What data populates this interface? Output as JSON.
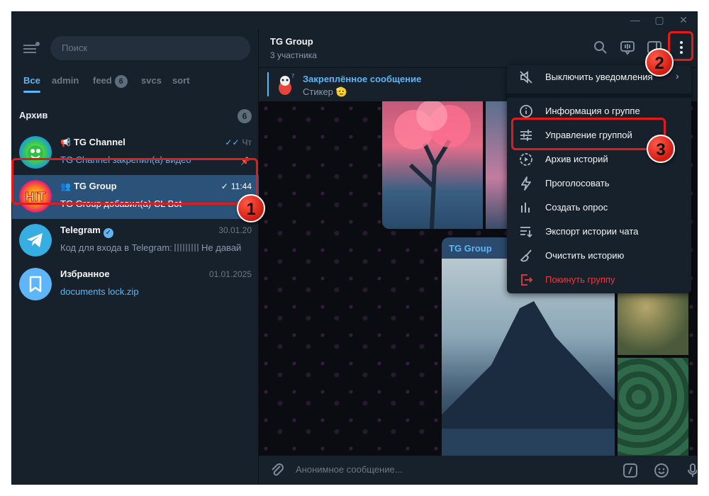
{
  "sidebar": {
    "search_placeholder": "Поиск",
    "tabs": [
      {
        "label": "Все"
      },
      {
        "label": "admin"
      },
      {
        "label": "feed",
        "badge": "6"
      },
      {
        "label": "svcs"
      },
      {
        "label": "sort"
      }
    ],
    "archive": {
      "title": "Архив",
      "count": "6"
    },
    "chats": [
      {
        "name": "TG Channel",
        "time": "Чт",
        "message": "TG Channel закрепил(а) видео"
      },
      {
        "name": "TG Group",
        "time": "11:44",
        "message": "TG Group добавил(а) CL Bot",
        "avatar_text": "HIT"
      },
      {
        "name": "Telegram",
        "time": "30.01.20",
        "message_prefix": "Код для входа в Telegram:",
        "message_suffix": "Не давай"
      },
      {
        "name": "Избранное",
        "time": "01.01.2025",
        "message": "documents lock.zip"
      }
    ]
  },
  "header": {
    "title": "TG Group",
    "subtitle": "3 участника"
  },
  "pinned": {
    "title": "Закреплённое сообщение",
    "text": "Стикер 🫡"
  },
  "album": {
    "caption": "TG Group"
  },
  "composer": {
    "placeholder": "Анонимное сообщение..."
  },
  "menu": {
    "items": [
      {
        "label": "Выключить уведомления"
      },
      {
        "label": "Информация о группе"
      },
      {
        "label": "Управление группой"
      },
      {
        "label": "Архив историй"
      },
      {
        "label": "Проголосовать"
      },
      {
        "label": "Создать опрос"
      },
      {
        "label": "Экспорт истории чата"
      },
      {
        "label": "Очистить историю"
      },
      {
        "label": "Покинуть группу"
      }
    ]
  },
  "annotations": {
    "step1": "1",
    "step2": "2",
    "step3": "3"
  },
  "colors": {
    "accent": "#5eb5f7",
    "selected": "#2b5278",
    "danger": "#ec3942",
    "highlight": "#e31b1b"
  }
}
